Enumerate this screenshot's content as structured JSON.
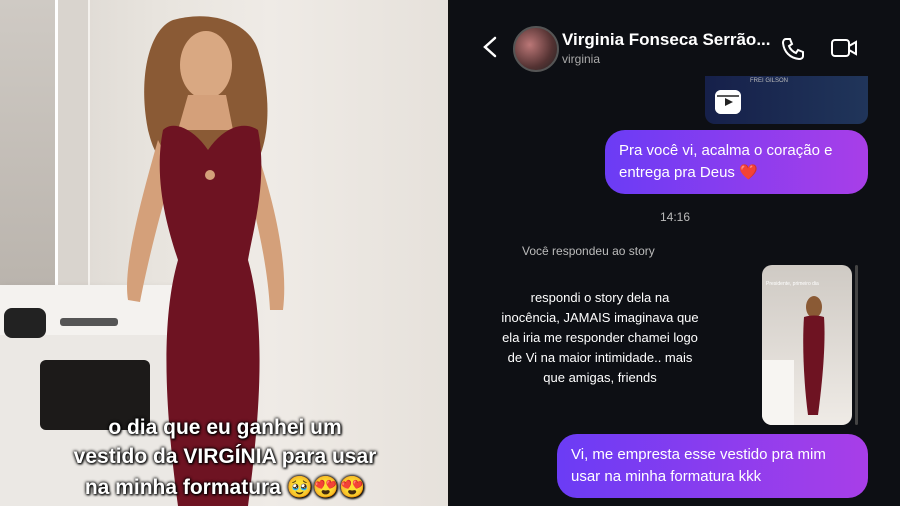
{
  "left_panel": {
    "caption_lines": [
      "o dia que eu ganhei um",
      "vestido da VIRGÍNIA para usar",
      "na minha formatura 🥹😍😍"
    ]
  },
  "chat_header": {
    "name": "Virginia Fonseca Serrão...",
    "handle": "virginia",
    "back_icon": "chevron-left",
    "call_icon": "phone",
    "video_icon": "video-camera"
  },
  "messages": {
    "reel_preview_text": "FREI GILSON",
    "msg1": "Pra você vi, acalma o coração e entrega pra Deus ❤️",
    "timestamp": "14:16",
    "story_reply_label": "Você respondeu ao story",
    "story_thumb_caption": "Presidente, primeiro dia",
    "annotation": "respondi o story dela na inocência, JAMAIS imaginava que ela iria me responder chamei logo de Vi na maior intimidade.. mais que amigas, friends",
    "msg2": "Vi, me empresta esse vestido pra mim usar na minha formatura kkk"
  },
  "colors": {
    "bubble_start": "#6b3cf5",
    "bubble_end": "#a83ee8",
    "dress": "#6e1322",
    "chat_bg": "#0d0f14"
  }
}
